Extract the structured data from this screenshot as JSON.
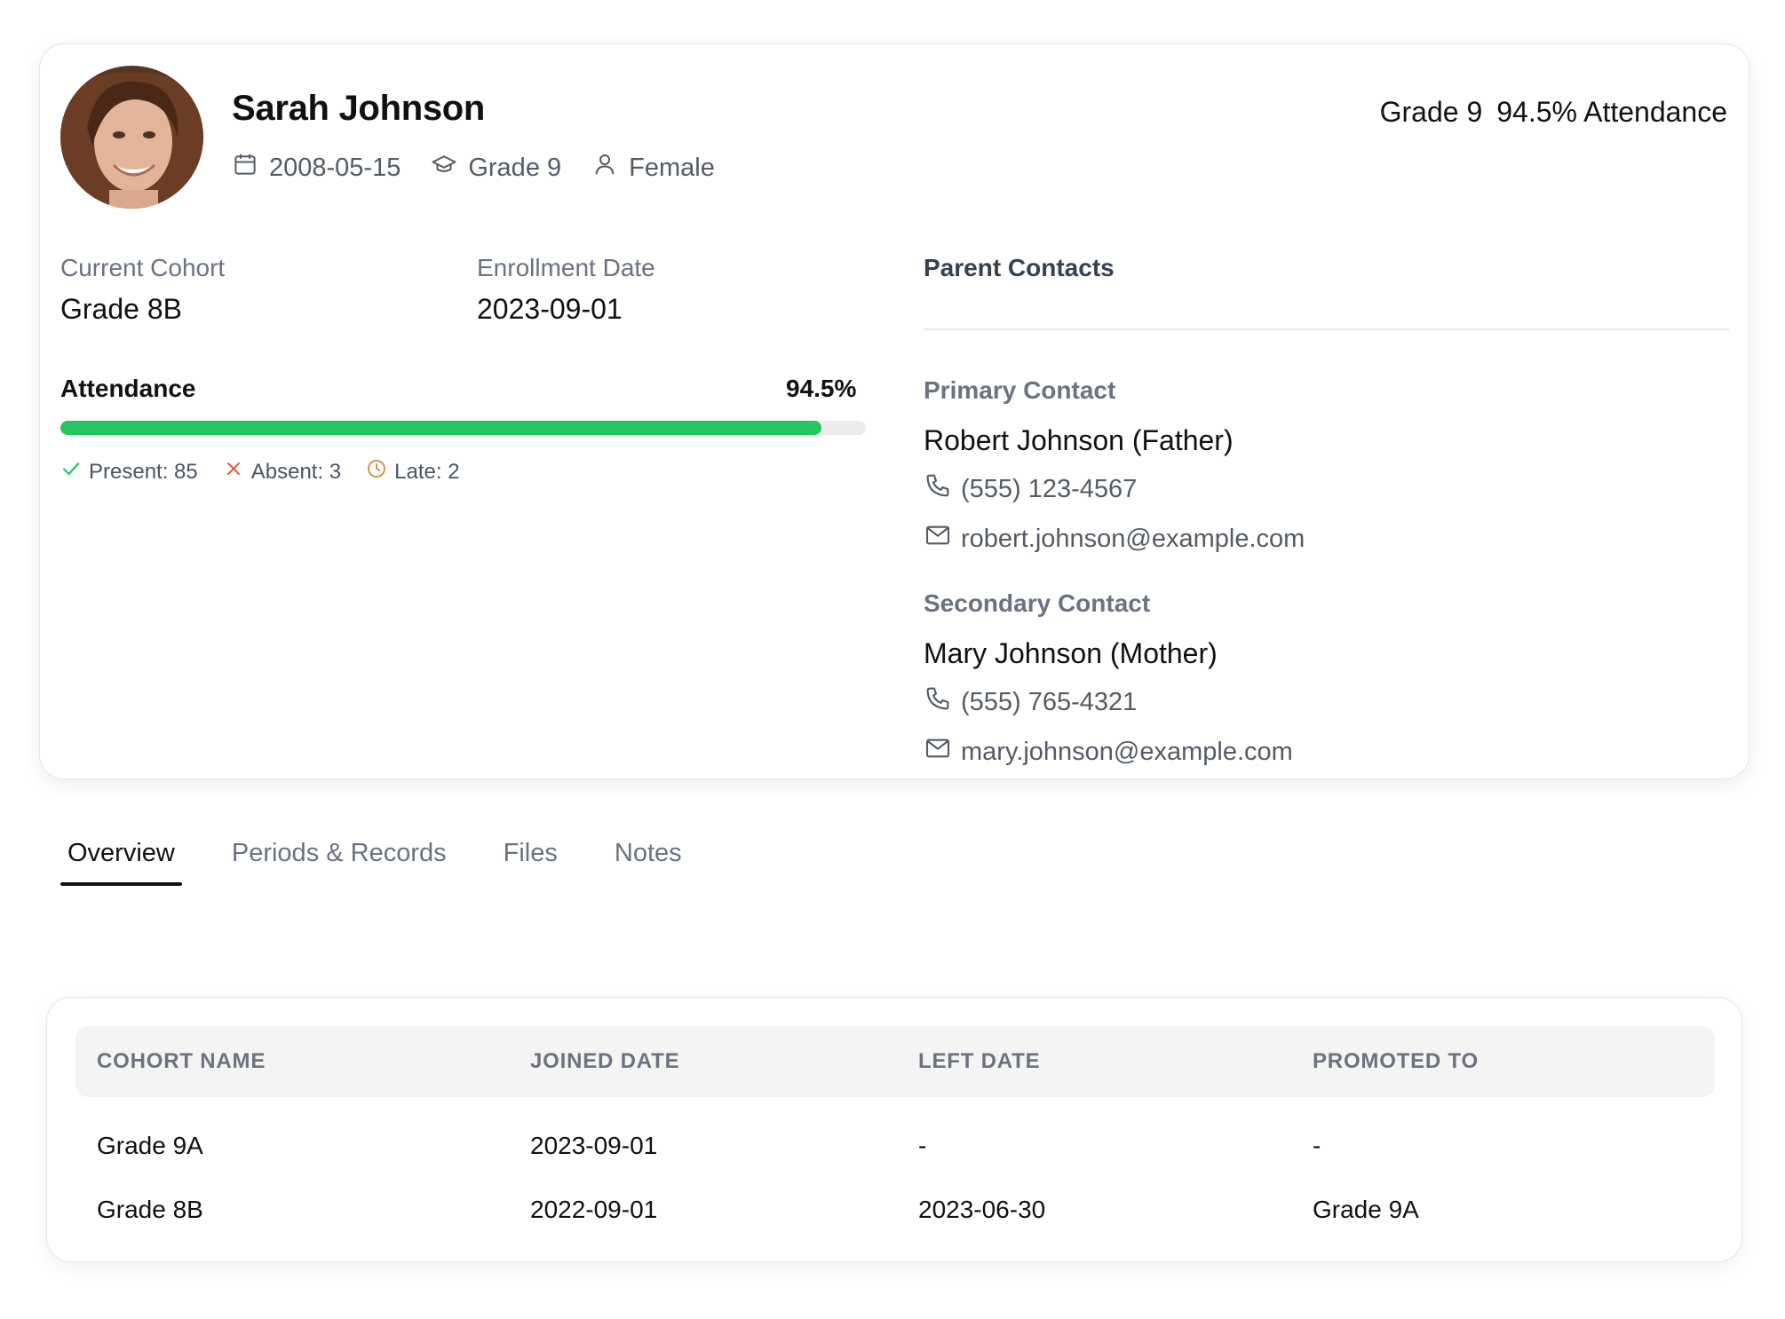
{
  "student": {
    "name": "Sarah Johnson",
    "birth_date": "2008-05-15",
    "grade": "Grade 9",
    "gender": "Female",
    "summary_grade": "Grade 9",
    "summary_attendance": "94.5% Attendance"
  },
  "details": {
    "cohort_label": "Current Cohort",
    "cohort_value": "Grade 8B",
    "enrollment_label": "Enrollment Date",
    "enrollment_value": "2023-09-01"
  },
  "attendance": {
    "title": "Attendance",
    "percent_label": "94.5%",
    "percent": 94.5,
    "present": "Present: 85",
    "absent": "Absent: 3",
    "late": "Late: 2",
    "colors": {
      "fill": "#22c55e",
      "present": "#22c55e",
      "absent": "#e25b45",
      "late": "#d08a3a"
    }
  },
  "contacts": {
    "heading": "Parent Contacts",
    "primary": {
      "role": "Primary Contact",
      "name": "Robert Johnson (Father)",
      "phone": "(555) 123-4567",
      "email": "robert.johnson@example.com"
    },
    "secondary": {
      "role": "Secondary Contact",
      "name": "Mary Johnson (Mother)",
      "phone": "(555) 765-4321",
      "email": "mary.johnson@example.com"
    }
  },
  "tabs": [
    {
      "label": "Overview",
      "active": true
    },
    {
      "label": "Periods & Records",
      "active": false
    },
    {
      "label": "Files",
      "active": false
    },
    {
      "label": "Notes",
      "active": false
    }
  ],
  "cohort_table": {
    "headers": [
      "COHORT NAME",
      "JOINED DATE",
      "LEFT DATE",
      "PROMOTED TO"
    ],
    "rows": [
      [
        "Grade 9A",
        "2023-09-01",
        "-",
        "-"
      ],
      [
        "Grade 8B",
        "2022-09-01",
        "2023-06-30",
        "Grade 9A"
      ]
    ]
  }
}
